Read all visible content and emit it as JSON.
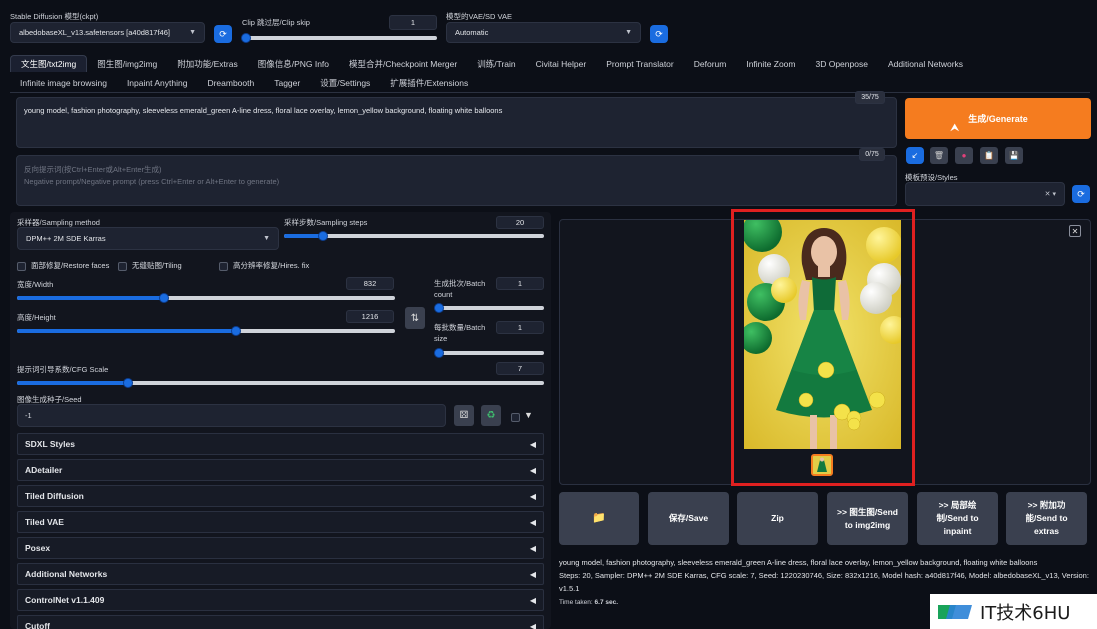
{
  "top": {
    "ckpt_label": "Stable Diffusion 模型(ckpt)",
    "ckpt_value": "albedobaseXL_v13.safetensors [a40d817f46]",
    "clip_label": "Clip 跳过层/Clip skip",
    "clip_value": "1",
    "vae_label": "模型的VAE/SD VAE",
    "vae_value": "Automatic"
  },
  "tabs_row1": [
    "文生图/txt2img",
    "图生图/img2img",
    "附加功能/Extras",
    "图像信息/PNG Info",
    "模型合并/Checkpoint Merger",
    "训练/Train",
    "Civitai Helper",
    "Prompt Translator",
    "Deforum",
    "Infinite Zoom",
    "3D Openpose",
    "Additional Networks"
  ],
  "tabs_row2": [
    "Infinite image browsing",
    "Inpaint Anything",
    "Dreambooth",
    "Tagger",
    "设置/Settings",
    "扩展插件/Extensions"
  ],
  "prompt": {
    "text": "young model, fashion photography, sleeveless emerald_green A-line dress, floral lace overlay, lemon_yellow background, floating white balloons",
    "count": "35/75",
    "neg_placeholder": "反向提示词(按Ctrl+Enter或Alt+Enter生成)\nNegative prompt/Negative prompt (press Ctrl+Enter or Alt+Enter to generate)",
    "neg_count": "0/75"
  },
  "generate_label": "生成/Generate",
  "styles_label": "模板预设/Styles",
  "sampler": {
    "method_label": "采样器/Sampling method",
    "method_value": "DPM++ 2M SDE Karras",
    "steps_label": "采样步数/Sampling steps",
    "steps_value": "20",
    "steps_fraction": 0.15
  },
  "checks": [
    "面部修复/Restore faces",
    "无缝贴图/Tiling",
    "高分辨率修复/Hires. fix"
  ],
  "width": {
    "label": "宽度/Width",
    "value": "832",
    "fraction": 0.39
  },
  "height": {
    "label": "高度/Height",
    "value": "1216",
    "fraction": 0.58
  },
  "batch_count": {
    "label": "生成批次/Batch count",
    "value": "1",
    "fraction": 0.0
  },
  "batch_size": {
    "label": "每批数量/Batch size",
    "value": "1",
    "fraction": 0.0
  },
  "cfg": {
    "label": "提示词引导系数/CFG Scale",
    "value": "7",
    "fraction": 0.21
  },
  "seed": {
    "label": "图像生成种子/Seed",
    "value": "-1"
  },
  "accordions": [
    "SDXL Styles",
    "ADetailer",
    "Tiled Diffusion",
    "Tiled VAE",
    "Posex",
    "Additional Networks",
    "ControlNet v1.1.409",
    "Cutoff"
  ],
  "output_buttons": [
    "保存/Save",
    "Zip",
    ">> 图生图/Send to img2img",
    ">> 局部绘制/Send to inpaint",
    ">> 附加功能/Send to extras"
  ],
  "info": {
    "prompt": "young model, fashion photography, sleeveless emerald_green A-line dress, floral lace overlay, lemon_yellow background, floating white balloons",
    "params": "Steps: 20, Sampler: DPM++ 2M SDE Karras, CFG scale: 7, Seed: 1220230746, Size: 832x1216, Model hash: a40d817f46, Model: albedobaseXL_v13, Version: v1.5.1",
    "time_label": "Time taken:",
    "time_value": "6.7 sec."
  },
  "watermark": "IT技术6HU",
  "colors": {
    "accent": "#1a6ce0",
    "generate": "#f57c1f",
    "highlight": "#e02020",
    "bg": "#0c0f17"
  }
}
